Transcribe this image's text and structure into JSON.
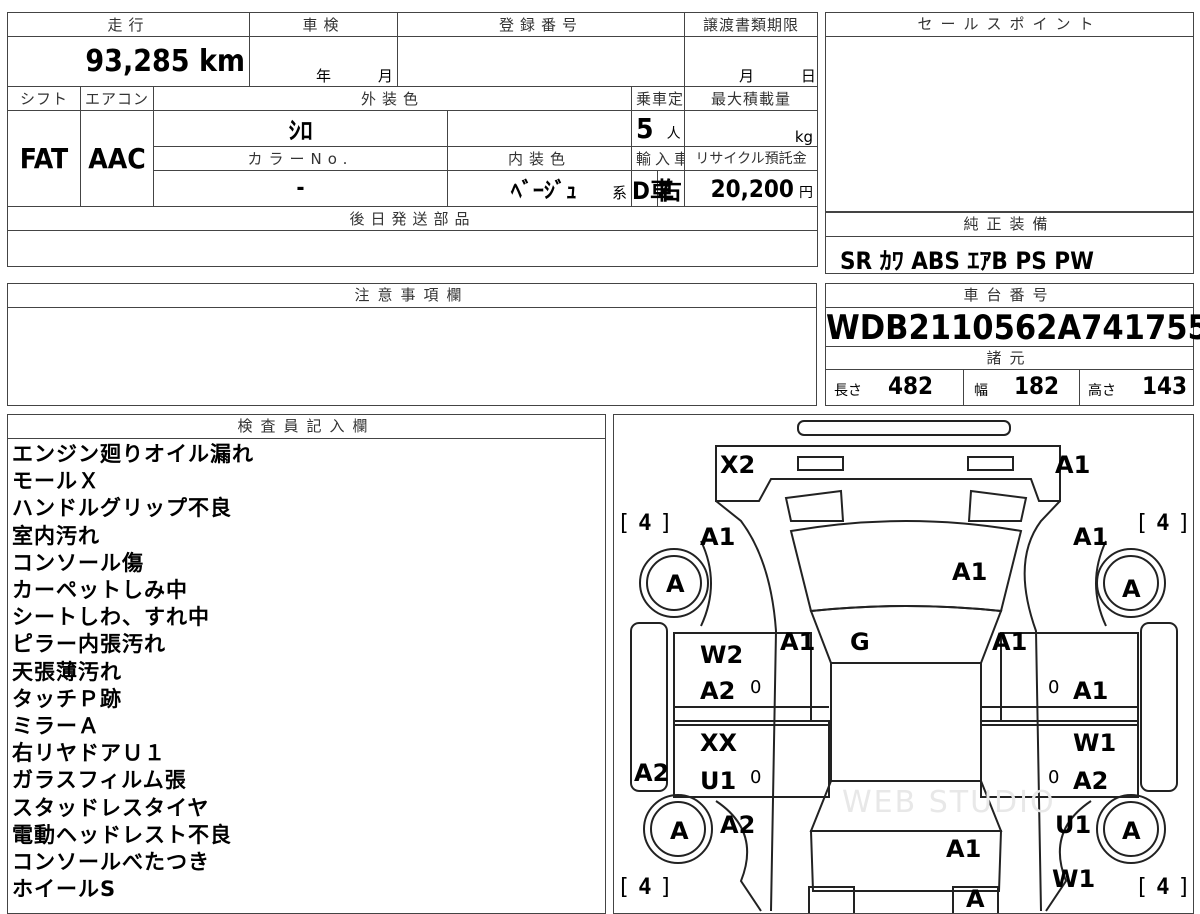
{
  "top": {
    "headers": {
      "mileage": "走行",
      "inspection": "車検",
      "reg_no": "登録番号",
      "transfer": "譲渡書類期限",
      "shift": "シフト",
      "aircon": "エアコン",
      "ext_color": "外装色",
      "capacity": "乗車定員",
      "max_load": "最大積載量",
      "color_no": "カラーNo.",
      "int_color": "内装色",
      "import": "輸入車",
      "recycle": "リサイクル預託金",
      "later_parts": "後日発送部品"
    },
    "mileage": "93,285 km",
    "year_unit": "年",
    "month_unit": "月",
    "transfer_month": "月",
    "transfer_day": "日",
    "shift": "FAT",
    "aircon": "AAC",
    "ext_color": "ｼﾛ",
    "capacity": "5",
    "capacity_unit": "人",
    "load_unit": "kg",
    "color_no": "-",
    "int_color": "ﾍﾞｰｼﾞｭ",
    "int_suffix": "系",
    "import_type": "D車",
    "handle": "右H",
    "recycle": "20,200",
    "recycle_unit": "円"
  },
  "sales": {
    "header": "セールスポイント"
  },
  "equip": {
    "header": "純正装備",
    "items": "SR ｶﾜ ABS ｴｱB PS PW"
  },
  "caution": {
    "header": "注意事項欄"
  },
  "chassis": {
    "header": "車台番号",
    "number": "WDB2110562A741755"
  },
  "specs": {
    "header": "諸元",
    "length_label": "長さ",
    "length": "482",
    "width_label": "幅",
    "width": "182",
    "height_label": "高さ",
    "height": "143"
  },
  "inspector": {
    "header": "検査員記入欄",
    "notes": [
      "エンジン廻りオイル漏れ",
      "モールＸ",
      "ハンドルグリップ不良",
      "室内汚れ",
      "コンソール傷",
      "カーペットしみ中",
      "シートしわ、すれ中",
      "ピラー内張汚れ",
      "天張薄汚れ",
      "タッチＰ跡",
      "ミラーＡ",
      "右リヤドアＵ１",
      "ガラスフィルム張",
      "スタッドレスタイヤ",
      "電動ヘッドレスト不良",
      "コンソールべたつき",
      "ホイールS"
    ]
  },
  "diagram": {
    "marks": {
      "front_left_bumper": "X2",
      "front_right_bumper": "A1",
      "left_fender": "A1",
      "right_fender": "A1",
      "bonnet": "A1",
      "windshield": "G",
      "left_pillar": "A1",
      "right_pillar": "A1",
      "left_front_door_top": "W2",
      "left_front_door": "A2",
      "right_front_door": "A1",
      "left_rear_door_top": "XX",
      "left_rear_door": "U1",
      "right_rear_door_top": "W1",
      "right_rear_door": "A2",
      "left_rocker": "A2",
      "left_rear_fender": "A2",
      "right_rear_fender": "U1",
      "rear_right_corner": "W1",
      "trunk": "A1",
      "rear_bumper": "A",
      "wheel_fl": "A",
      "wheel_fr": "A",
      "wheel_rl": "A",
      "wheel_rr": "A",
      "tire_fl": "4",
      "tire_fr": "4",
      "tire_rl": "4",
      "tire_rr": "4",
      "zero": "0"
    },
    "watermark": "WEB STUDIO"
  }
}
